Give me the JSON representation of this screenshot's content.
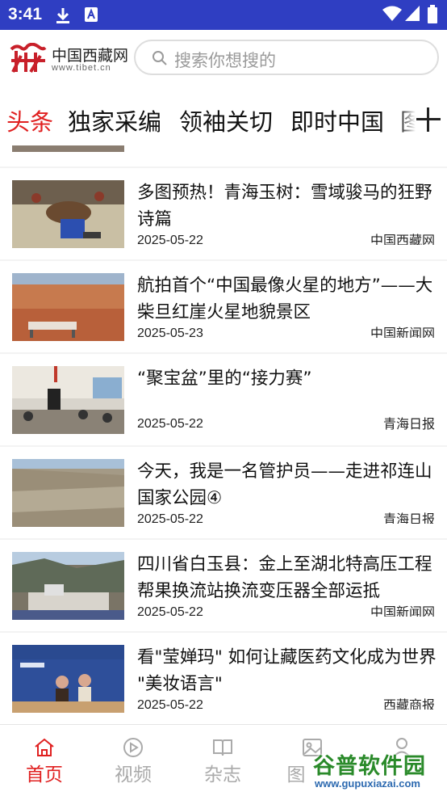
{
  "status_bar": {
    "time": "3:41"
  },
  "header": {
    "logo_cn": "中国西藏网",
    "logo_en": "www.tibet.cn",
    "search_placeholder": "搜索你想搜的"
  },
  "tabs": [
    {
      "label": "头条",
      "active": true
    },
    {
      "label": "独家采编",
      "active": false
    },
    {
      "label": "领袖关切",
      "active": false
    },
    {
      "label": "即时中国",
      "active": false
    },
    {
      "label": "图",
      "active": false
    }
  ],
  "news": [
    {
      "title": "多图预热！青海玉树：雪域骏马的狂野诗篇",
      "date": "2025-05-22",
      "source": "中国西藏网",
      "thumb": "horse-race-photo"
    },
    {
      "title": "航拍首个“中国最像火星的地方”——大柴旦红崖火星地貌景区",
      "date": "2025-05-23",
      "source": "中国新闻网",
      "thumb": "mars-landscape-photo"
    },
    {
      "title": "“聚宝盆”里的“接力赛”",
      "date": "2025-05-22",
      "source": "青海日报",
      "thumb": "classroom-photo"
    },
    {
      "title": "今天，我是一名管护员——走进祁连山国家公园④",
      "date": "2025-05-22",
      "source": "青海日报",
      "thumb": "hillside-herd-photo"
    },
    {
      "title": "四川省白玉县：金上至湖北特高压工程帮果换流站换流变压器全部运抵",
      "date": "2025-05-22",
      "source": "中国新闻网",
      "thumb": "converter-station-photo"
    },
    {
      "title": "看\"莹婵玛\" 如何让藏医药文化成为世界 \"美妆语言\"",
      "date": "2025-05-22",
      "source": "西藏商报",
      "thumb": "exhibition-photo"
    }
  ],
  "bottom_nav": [
    {
      "label": "首页",
      "icon": "home-icon",
      "active": true
    },
    {
      "label": "视频",
      "icon": "play-icon",
      "active": false
    },
    {
      "label": "杂志",
      "icon": "book-icon",
      "active": false
    },
    {
      "label": "图",
      "icon": "image-icon",
      "active": false
    },
    {
      "label": "",
      "icon": "user-icon",
      "active": false
    }
  ],
  "watermark": {
    "name": "谷普软件园",
    "url": "www.gupuxiazai.com"
  },
  "colors": {
    "status_bar": "#2f3ec2",
    "accent": "#e02020"
  }
}
